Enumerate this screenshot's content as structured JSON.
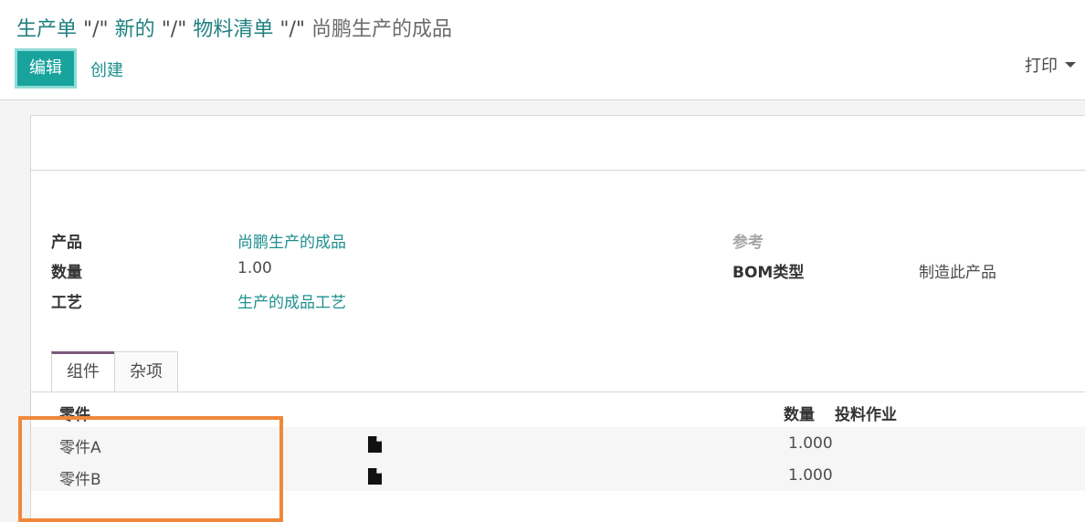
{
  "breadcrumb": {
    "items": [
      "生产单",
      "新的",
      "物料清单"
    ],
    "separator": "\"/\"",
    "current": "尚鹏生产的成品"
  },
  "toolbar": {
    "edit_label": "编辑",
    "create_label": "创建",
    "print_label": "打印"
  },
  "form": {
    "product_label": "产品",
    "product_value": "尚鹏生产的成品",
    "quantity_label": "数量",
    "quantity_value": "1.00",
    "routing_label": "工艺",
    "routing_value": "生产的成品工艺",
    "reference_label": "参考",
    "bom_type_label": "BOM类型",
    "bom_type_value": "制造此产品"
  },
  "tabs": [
    "组件",
    "杂项"
  ],
  "components": {
    "headers": {
      "part": "零件",
      "quantity": "数量",
      "operation": "投料作业"
    },
    "rows": [
      {
        "part": "零件A",
        "quantity": "1.000"
      },
      {
        "part": "零件B",
        "quantity": "1.000"
      }
    ]
  },
  "colors": {
    "primary": "#18a39c",
    "link": "#1f8f8f",
    "tab_accent": "#7c5a7c",
    "highlight": "#f0883a"
  },
  "icons": {
    "row_document": "document-icon",
    "print_caret": "caret-down-icon"
  }
}
